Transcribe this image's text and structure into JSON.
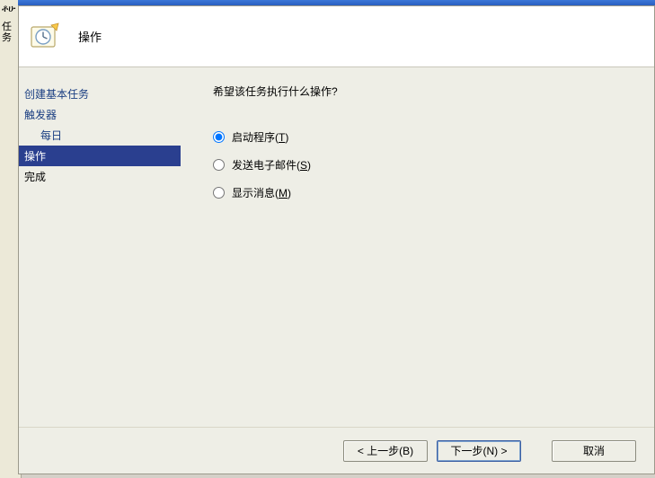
{
  "backdrop": {
    "top_label": "ቶ‍ሁ",
    "side_label": "任务"
  },
  "header": {
    "title": "操作"
  },
  "sidebar": {
    "items": [
      {
        "label": "创建基本任务",
        "kind": "link"
      },
      {
        "label": "触发器",
        "kind": "link"
      },
      {
        "label": "每日",
        "kind": "link-indent"
      },
      {
        "label": "操作",
        "kind": "selected"
      },
      {
        "label": "完成",
        "kind": "plain"
      }
    ]
  },
  "content": {
    "question": "希望该任务执行什么操作?",
    "options": [
      {
        "label": "启动程序(",
        "accel": "T",
        "tail": ")",
        "checked": true
      },
      {
        "label": "发送电子邮件(",
        "accel": "S",
        "tail": ")",
        "checked": false
      },
      {
        "label": "显示消息(",
        "accel": "M",
        "tail": ")",
        "checked": false
      }
    ]
  },
  "footer": {
    "back": "< 上一步(B)",
    "next": "下一步(N) >",
    "cancel": "取消"
  }
}
